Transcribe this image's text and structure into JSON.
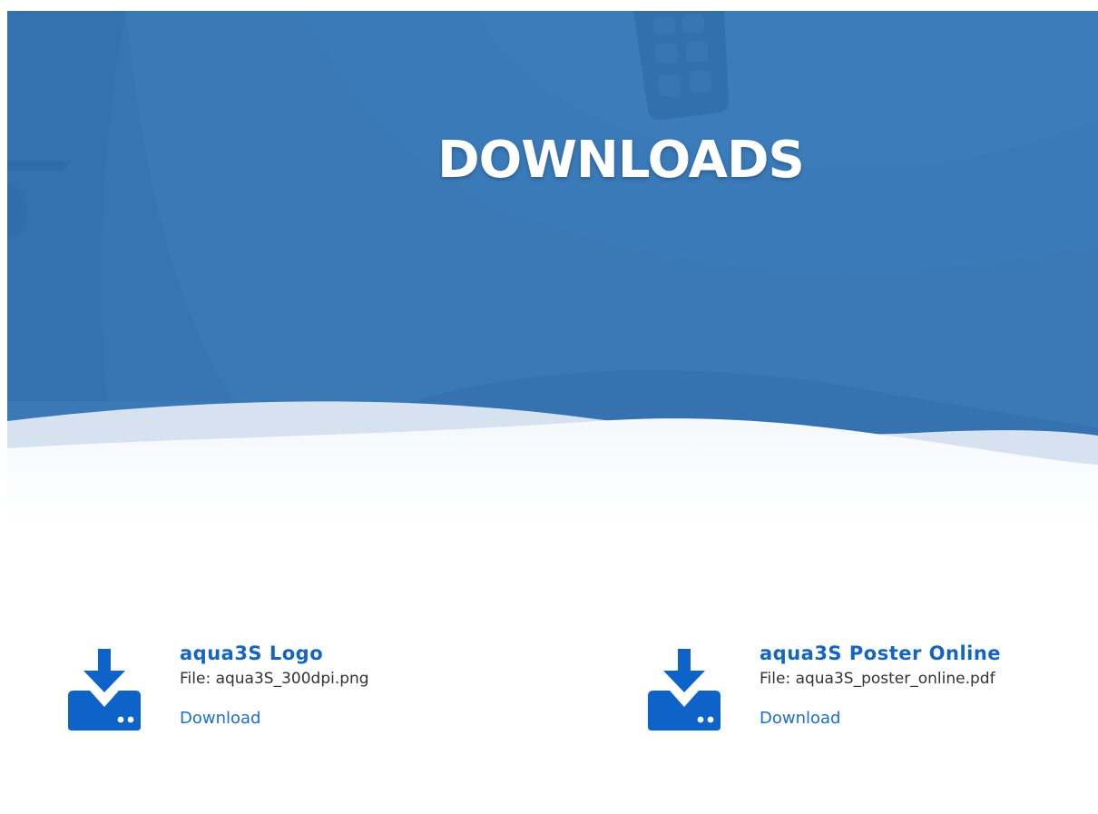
{
  "hero": {
    "title": "DOWNLOADS"
  },
  "colors": {
    "hero_blue": "#3a78b6",
    "accent_blue": "#1565c0",
    "link_blue": "#1e6fc6",
    "icon_blue": "#0d63c8"
  },
  "downloads": [
    {
      "icon": "download-server-icon",
      "title": "aqua3S Logo",
      "file": "File: aqua3S_300dpi.png",
      "link_label": "Download"
    },
    {
      "icon": "download-server-icon",
      "title": "aqua3S Poster Online",
      "file": "File: aqua3S_poster_online.pdf",
      "link_label": "Download"
    }
  ]
}
